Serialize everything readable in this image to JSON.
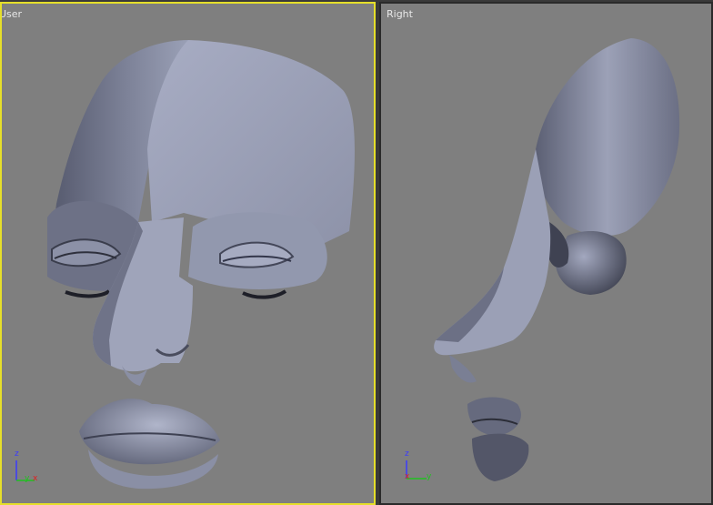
{
  "viewports": {
    "user": {
      "label": "User",
      "active": true,
      "border_color": "#e6df2a"
    },
    "right": {
      "label": "Right",
      "active": false,
      "border_color": "#2a2a2a"
    }
  },
  "axis_tripod": {
    "user": {
      "z": "z",
      "x": "x",
      "y": "y"
    },
    "right": {
      "z": "z",
      "x": "x",
      "y": "y"
    }
  },
  "colors": {
    "viewport_bg": "#7f7f7f",
    "mesh_light": "#a3a8bf",
    "mesh_dark": "#4d5062"
  }
}
